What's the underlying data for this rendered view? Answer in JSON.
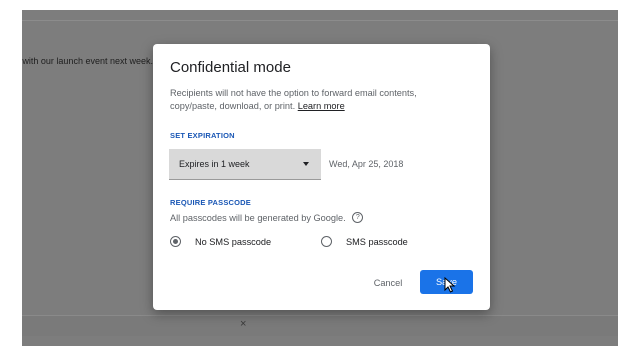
{
  "background": {
    "email_snippet": "o with our launch event next week.",
    "bottom_bar_close": "×"
  },
  "dialog": {
    "title": "Confidential mode",
    "description": "Recipients will not have the option to forward email contents, copy/paste, download, or print.",
    "learn_more": "Learn more",
    "expiration": {
      "label": "SET EXPIRATION",
      "selected": "Expires in 1 week",
      "date": "Wed, Apr 25, 2018"
    },
    "passcode": {
      "label": "REQUIRE PASSCODE",
      "note": "All passcodes will be generated by Google.",
      "help_icon": "?",
      "options": [
        "No SMS passcode",
        "SMS passcode"
      ],
      "selected": "No SMS passcode"
    },
    "cancel_label": "Cancel",
    "save_label": "Save"
  },
  "colors": {
    "overlay": "#7d7d7d",
    "accent": "#1a73e8",
    "section_label": "#1a57b5"
  },
  "icons": {
    "help": "help-circle-icon",
    "caret": "dropdown-caret-icon",
    "cursor": "mouse-pointer-icon"
  }
}
